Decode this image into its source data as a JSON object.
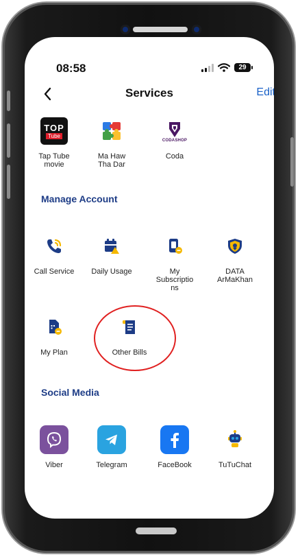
{
  "status_bar": {
    "time": "08:58",
    "battery": "29"
  },
  "header": {
    "title": "Services",
    "edit_label": "Edit"
  },
  "top_items": [
    {
      "label_line1": "Tap Tube",
      "label_line2": "movie",
      "logo_line1": "TOP",
      "logo_line2": "Tube"
    },
    {
      "label_line1": "Ma Haw",
      "label_line2": "Tha Dar"
    },
    {
      "label": "Coda",
      "logo_text": "CODASHOP"
    }
  ],
  "manage_account": {
    "title": "Manage Account",
    "items": [
      {
        "label": "Call Service"
      },
      {
        "label": "Daily Usage"
      },
      {
        "label_line1": "My",
        "label_line2": "Subscriptio",
        "label_line3": "ns"
      },
      {
        "label_line1": "DATA",
        "label_line2": "ArMaKhan"
      },
      {
        "label": "My Plan"
      },
      {
        "label": "Other Bills"
      }
    ]
  },
  "social_media": {
    "title": "Social Media",
    "items": [
      {
        "label": "Viber"
      },
      {
        "label": "Telegram"
      },
      {
        "label": "FaceBook"
      },
      {
        "label": "TuTuChat"
      }
    ]
  },
  "colors": {
    "accent_blue": "#1a62c8",
    "section_title": "#1d3c86",
    "icon_yellow": "#f5b800",
    "viber": "#7b519d",
    "telegram": "#2aa3e0",
    "facebook": "#1877f2",
    "highlight": "#e02020"
  }
}
